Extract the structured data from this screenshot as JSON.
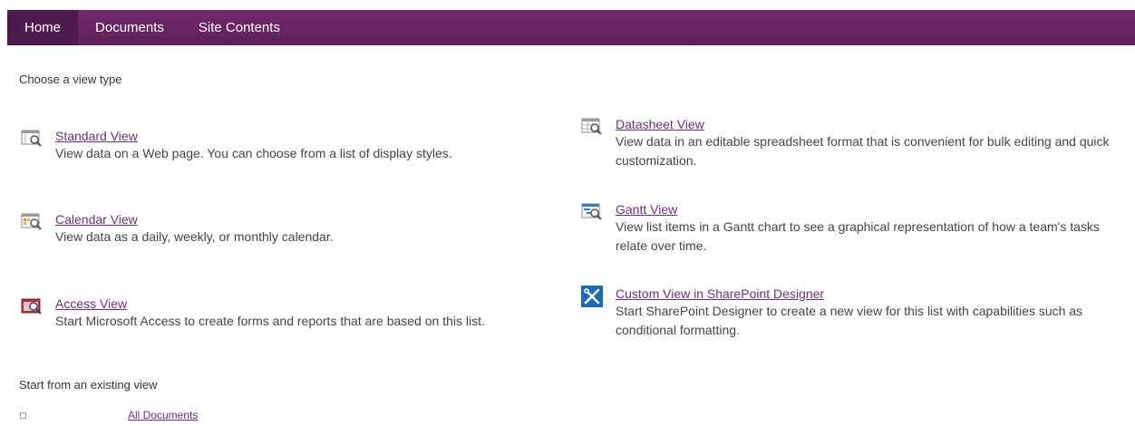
{
  "nav": {
    "tabs": [
      {
        "label": "Home"
      },
      {
        "label": "Documents"
      },
      {
        "label": "Site Contents"
      }
    ]
  },
  "choose_label": "Choose a view type",
  "views": {
    "standard": {
      "title": "Standard View",
      "desc": "View data on a Web page. You can choose from a list of display styles.",
      "icon": "standard-view-icon"
    },
    "datasheet": {
      "title": "Datasheet View",
      "desc": "View data in an editable spreadsheet format that is convenient for bulk editing and quick customization.",
      "icon": "datasheet-view-icon"
    },
    "calendar": {
      "title": "Calendar View",
      "desc": "View data as a daily, weekly, or monthly calendar.",
      "icon": "calendar-view-icon"
    },
    "gantt": {
      "title": "Gantt View",
      "desc": "View list items in a Gantt chart to see a graphical representation of how a team's tasks relate over time.",
      "icon": "gantt-view-icon"
    },
    "access": {
      "title": "Access View",
      "desc": "Start Microsoft Access to create forms and reports that are based on this list.",
      "icon": "access-view-icon"
    },
    "designer": {
      "title": "Custom View in SharePoint Designer",
      "desc": "Start SharePoint Designer to create a new view for this list with capabilities such as conditional formatting.",
      "icon": "sharepoint-designer-icon"
    }
  },
  "existing_label": "Start from an existing view",
  "existing_views": [
    {
      "label": "All Documents"
    }
  ],
  "colors": {
    "nav_bg": "#6e2a6a",
    "nav_selected": "#4f1a4c",
    "link": "#6b2f7e",
    "designer_icon_bg": "#1f6ab2"
  }
}
